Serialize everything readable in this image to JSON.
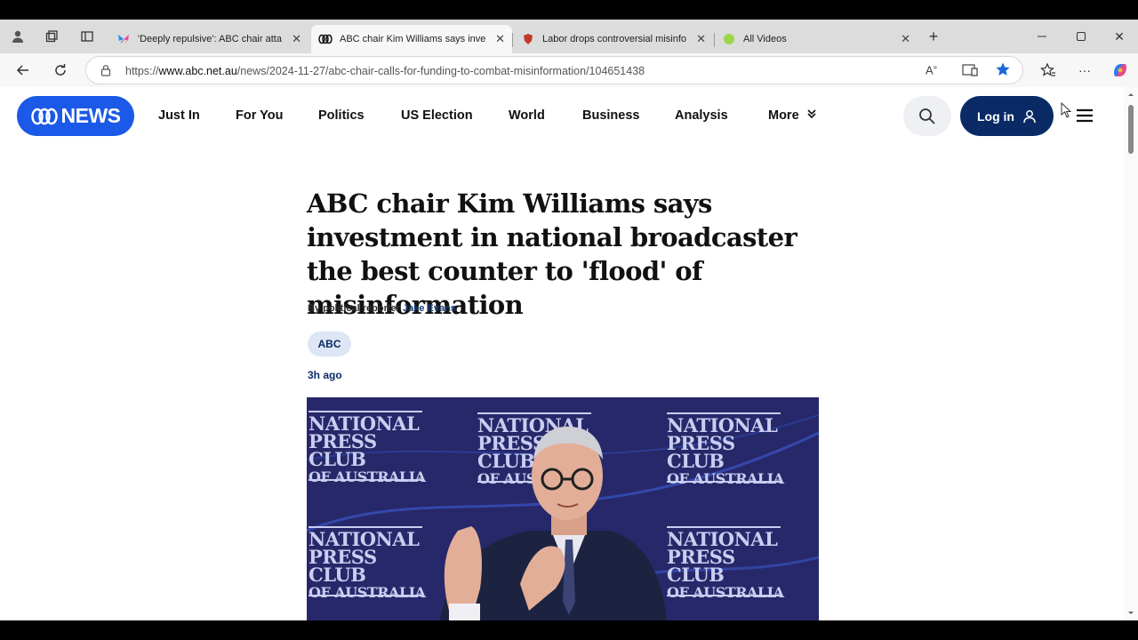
{
  "browser": {
    "tabs": [
      {
        "title": "'Deeply repulsive': ABC chair atta",
        "active": false
      },
      {
        "title": "ABC chair Kim Williams says inve",
        "active": true
      },
      {
        "title": "Labor drops controversial misinfo",
        "active": false
      },
      {
        "title": "All Videos",
        "active": false
      }
    ],
    "url_prefix": "https://",
    "url_domain": "www.abc.net.au",
    "url_path": "/news/2024-11-27/abc-chair-calls-for-funding-to-combat-misinformation/104651438"
  },
  "site": {
    "logo": "NEWS",
    "nav": [
      "Just In",
      "For You",
      "Politics",
      "US Election",
      "World",
      "Business",
      "Analysis",
      "More"
    ],
    "login_label": "Log in",
    "brand_color": "#1b59e8",
    "dark_navy": "#0a2a66"
  },
  "article": {
    "headline": "ABC chair Kim Williams says investment in national broadcaster the best counter to 'flood' of misinformation",
    "byline_prefix": "By political reporter",
    "author": "Jake Evans",
    "tag": "ABC",
    "time": "3h ago",
    "photo_backdrop_lines": [
      "NATIONAL",
      "PRESS CLUB",
      "OF AUSTRALIA"
    ]
  }
}
